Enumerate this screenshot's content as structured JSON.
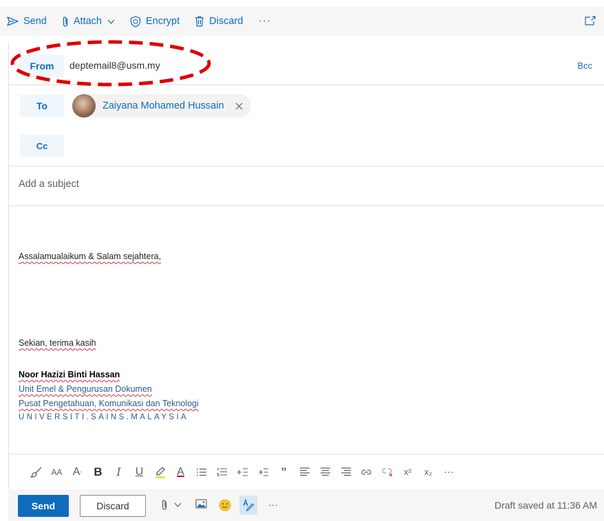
{
  "toolbar": {
    "send_label": "Send",
    "attach_label": "Attach",
    "encrypt_label": "Encrypt",
    "discard_label": "Discard",
    "more_label": "···"
  },
  "header": {
    "from_label": "From",
    "from_value": "deptemail8@usm.my",
    "bcc_label": "Bcc",
    "to_label": "To",
    "to_recipient": "Zaiyana Mohamed Hussain",
    "cc_label": "Cc",
    "subject_placeholder": "Add a subject"
  },
  "body": {
    "greeting": "Assalamualaikum & Salam sejahtera,",
    "closing": "Sekian, terima kasih",
    "signature": {
      "name": "Noor Hazizi Binti Hassan",
      "line1": "Unit Emel & Pengurusan Dokumen",
      "line2": "Pusat Pengetahuan, Komunikasi dan Teknologi",
      "line3": "UNIVERSITI.SAINS.MALAYSIA"
    }
  },
  "format_bar": {
    "font_size_label": "AA",
    "grow_label": "A",
    "bold_label": "B",
    "italic_label": "I",
    "underline_label": "U",
    "font_color_label": "A",
    "quote_label": "”",
    "superscript_label": "x²",
    "subscript_label": "x₂",
    "more_label": "···"
  },
  "footer": {
    "send_label": "Send",
    "discard_label": "Discard",
    "more_label": "···",
    "draft_status": "Draft saved at 11:36 AM"
  },
  "colors": {
    "accent": "#0f6cbd",
    "annotation": "#e00000"
  }
}
